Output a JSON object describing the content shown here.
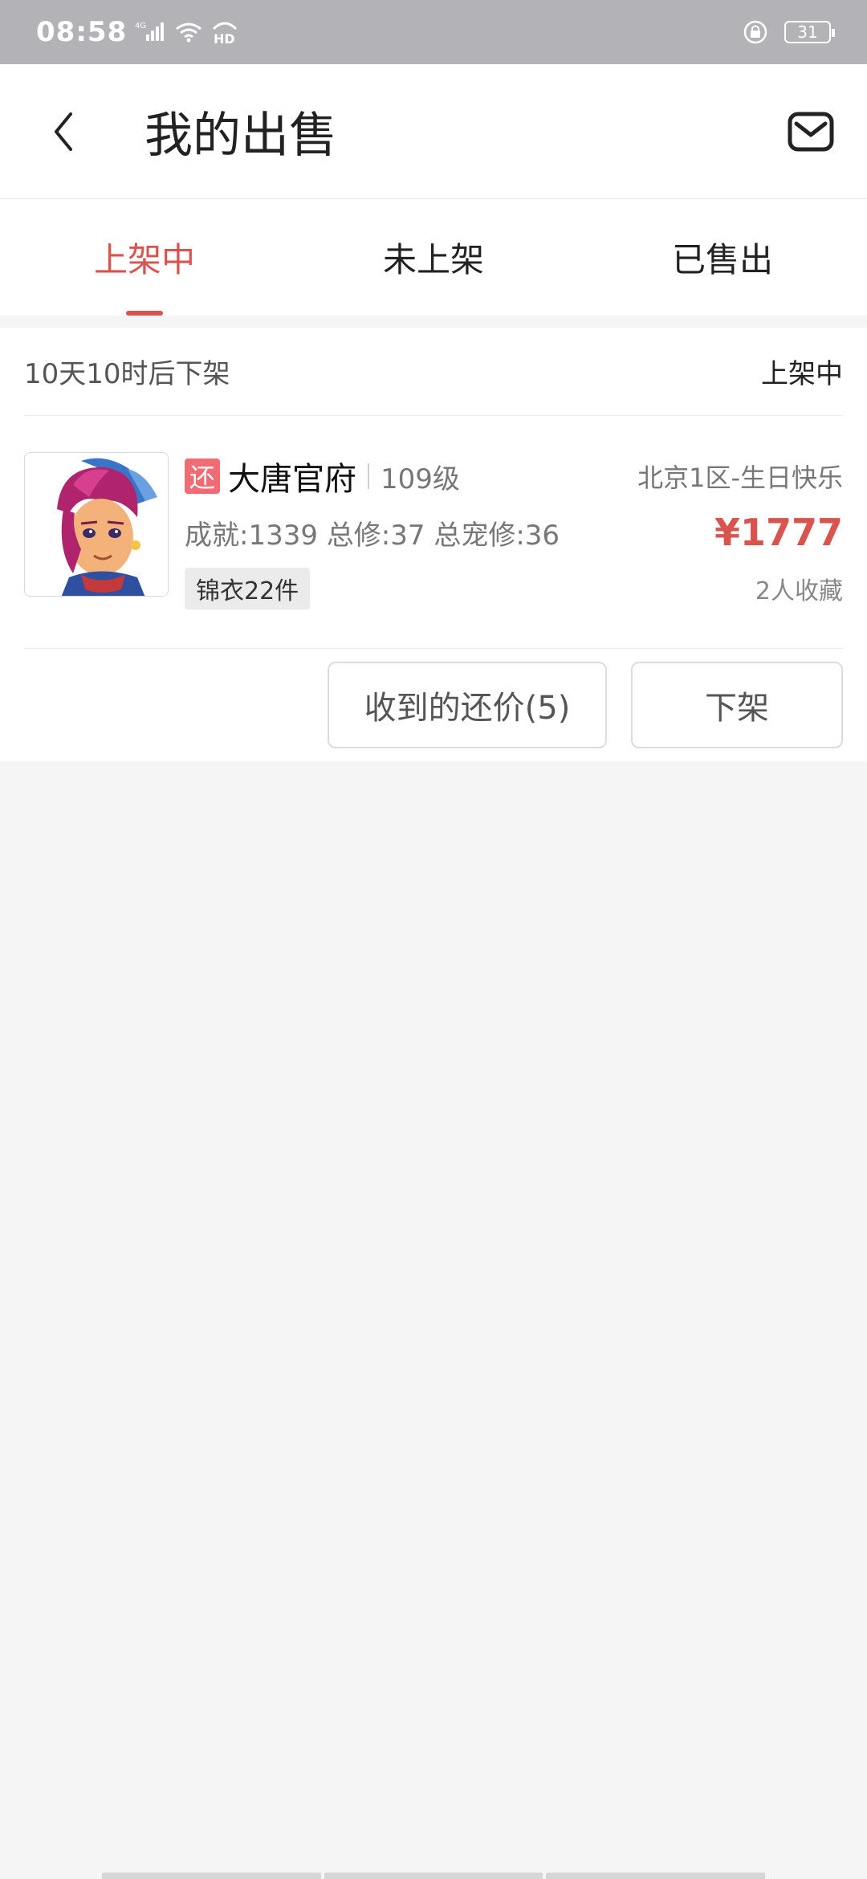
{
  "status_bar": {
    "time": "08:58",
    "network": "4G",
    "hd": "HD",
    "battery": "31"
  },
  "header": {
    "title": "我的出售",
    "back_icon": "chevron-left-icon",
    "mail_icon": "mail-icon"
  },
  "tabs": [
    {
      "label": "上架中",
      "active": true
    },
    {
      "label": "未上架",
      "active": false
    },
    {
      "label": "已售出",
      "active": false
    }
  ],
  "listing": {
    "expire_text": "10天10时后下架",
    "status": "上架中",
    "tag": "还",
    "school": "大唐官府",
    "level": "109级",
    "server": "北京1区-生日快乐",
    "stats": "成就:1339 总修:37 总宠修:36",
    "price": "¥1777",
    "badge": "锦衣22件",
    "favorites": "2人收藏",
    "buttons": {
      "offers": "收到的还价(5)",
      "delist": "下架"
    }
  },
  "colors": {
    "accent": "#d9534f",
    "status_bar_bg": "#b3b2b6",
    "tag_bg": "#f06b74",
    "page_bg": "#f5f5f5"
  }
}
